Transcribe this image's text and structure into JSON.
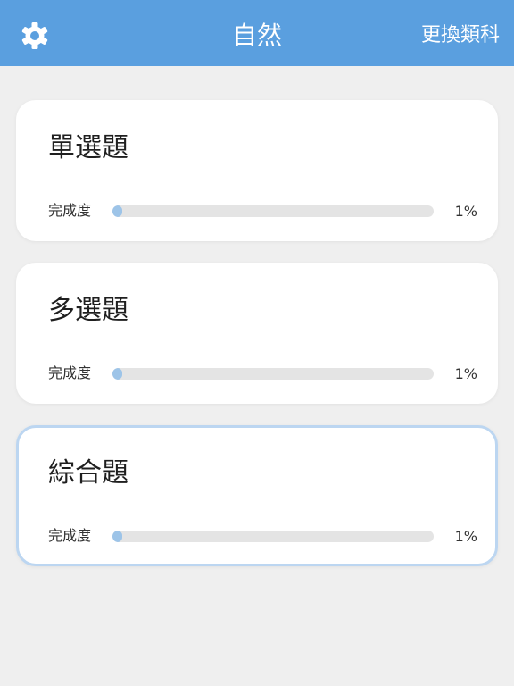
{
  "header": {
    "title": "自然",
    "switch_label": "更換類科",
    "settings_icon": "gear-icon",
    "background": "#5a9fdf"
  },
  "cards": [
    {
      "title": "單選題",
      "progress_label": "完成度",
      "progress": 0.01,
      "percent_text": "1%"
    },
    {
      "title": "多選題",
      "progress_label": "完成度",
      "progress": 0.01,
      "percent_text": "1%"
    },
    {
      "title": "綜合題",
      "progress_label": "完成度",
      "progress": 0.01,
      "percent_text": "1%",
      "selected": true
    }
  ],
  "colors": {
    "accent": "#5a9fdf",
    "progress_fill": "#9dc4e8",
    "progress_track": "#e4e4e4",
    "selected_border": "#bcd6f1"
  }
}
